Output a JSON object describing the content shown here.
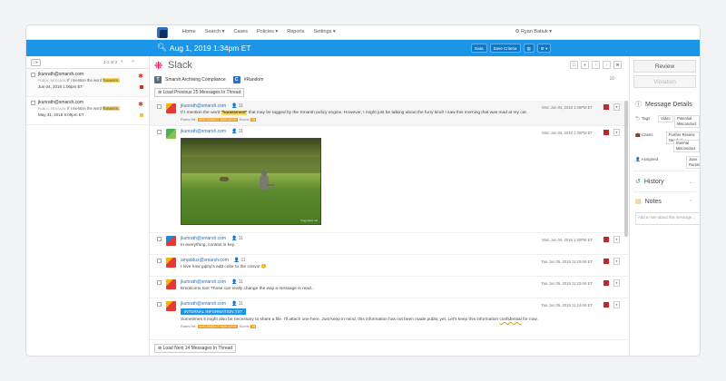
{
  "nav": {
    "items": [
      "Home",
      "Search ▾",
      "Cases",
      "Policies ▾",
      "Reports",
      "Settings ▾"
    ],
    "user": "⚙ Ryan Batiuk ▾"
  },
  "bar": {
    "date": "Aug 1, 2019 1:34pm ET",
    "data_btn": "Data",
    "save_btn": "Save Criteria",
    "b3": "▤",
    "b4": "⚙ ▾"
  },
  "list": {
    "checkbox": "☐▾",
    "count": "1-2 of 2",
    "nav": "« »",
    "items": [
      {
        "email": "jkunrath@smarsh.com",
        "tag": "PUBLIC MESSAGE",
        "pre": "If I mention the word ",
        "hl": "'harassm..",
        "date": "Jun 04, 2018 1:06pm ET"
      },
      {
        "email": "jkunrath@smarsh.com",
        "tag": "PUBLIC MESSAGE",
        "pre": "If I mention the word ",
        "hl": "'harassm..",
        "date": "May 31, 2018 6:09pm ET"
      }
    ]
  },
  "channel": {
    "title": "Slack",
    "p1": "Smarsh Archiving Compliance",
    "p2": "#Random",
    "p1_icon": "T",
    "p2_icon": "C",
    "load_prev": "⊕ Load Previous 25 Messages In Thread",
    "load_next": "⊕ Load Next 14 Messages In Thread",
    "tools": [
      "☐",
      "▾",
      "‹",
      "›",
      "✖"
    ],
    "parts_count": "10"
  },
  "messages": [
    {
      "from": "jkunrath@smarsh.com",
      "count": "👤 11",
      "date": "Mon Jun 04, 2018 1:06PM ET",
      "pre": "If I mention the word ",
      "hl": "\"harassment\"",
      "post": " that may be tagged by the Smarsh policy engine. However, I might just be talking about the furry kind! I saw this morning that was mad at my cat.",
      "rules": "Rules Hit:",
      "rtag": "MISCONDUCT INDICATOR",
      "score_label": "Score:",
      "score": "25"
    },
    {
      "from": "jkunrath@smarsh.com",
      "count": "👤 11",
      "date": "Mon Jun 04, 2018 1:30PM ET",
      "watermark": "Piggyback cat"
    },
    {
      "from": "jkunrath@smarsh.com",
      "count": "👤 11",
      "date": "Mon Jun 04, 2018 1:30PM ET",
      "text": "In everything, context is key."
    },
    {
      "from": "amaddux@smarsh.com",
      "count": "👤 11",
      "date": "Tue Jun 05, 2018 11:20AM ET",
      "text": "I love how giphy's add color to the convo! 😊"
    },
    {
      "from": "jkunrath@smarsh.com",
      "count": "👤 11",
      "date": "Tue Jun 05, 2018 11:23AM ET",
      "text": "Emoticons too! Those can really change the way a message is read..."
    },
    {
      "from": "jkunrath@smarsh.com",
      "count": "👤 11",
      "date": "Tue Jun 05, 2018 11:24AM ET",
      "attach": "INTERNAL INFORMATION.TXT",
      "pre": "Sometimes it might also be necessary to share a file. I'll attach one here. Just keep in mind, this information has not been made public yet. Let's keep this information ",
      "hl": "confidential",
      "post": " for now.",
      "rules": "Rules Hit:",
      "rtag": "MISCONDUCT INDICATOR",
      "score_label": "Score:",
      "score": "25"
    }
  ],
  "details": {
    "review": "Review",
    "violation": "Violation",
    "title": "Message Details",
    "tags_label": "🏷 Tags",
    "tag1": "Video",
    "tag2": "Potential Misconduct",
    "cases_label": "💼 Cases",
    "case1": "Further Review Needed",
    "case2": "Internal Misconduct",
    "assigned_label": "👤 Assigned",
    "assignee": "Juan Rurrath",
    "history": "History",
    "notes": "Notes",
    "notes_placeholder": "Add a note about this message..."
  }
}
